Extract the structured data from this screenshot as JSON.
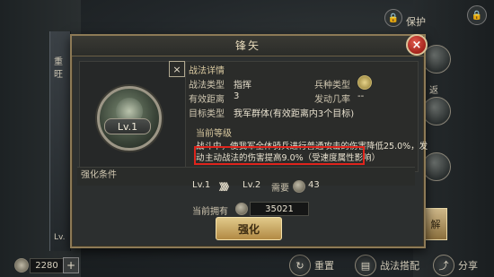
{
  "dialog": {
    "title": "锋矢",
    "close_icon": "×",
    "inner_close_icon": "×",
    "section_title": "战法详情",
    "level_badge": "Lv.1",
    "fields": {
      "type_label": "战法类型",
      "type_value": "指挥",
      "troop_label": "兵种类型",
      "range_label": "有效距离",
      "range_value": "3",
      "rate_label": "发动几率",
      "rate_value": "--",
      "target_label": "目标类型",
      "target_value": "我军群体(有效距离内3个目标)"
    },
    "current_level_label": "当前等级",
    "desc_line1": "战斗中，使我军全体骑兵进行普通攻击的伤害降低25.0%，发",
    "desc_line2_prefix": "动",
    "desc_line2": "主动战法的伤害提高9.0%（受速度属性影响）",
    "upgrade_label": "强化条件",
    "lv_from": "Lv.1",
    "arrows": "》》》",
    "lv_to": "Lv.2",
    "need_label": "需要",
    "need_amount": "43",
    "owned_label": "当前拥有",
    "owned_amount": "35021",
    "strengthen_button": "强化"
  },
  "background": {
    "lock_label": "保护",
    "back_label": "返",
    "solve_label": "解",
    "currency": "2280",
    "plus": "+",
    "reset_label": "重置",
    "combo_label": "战法搭配",
    "share_label": "分享",
    "left_text_1": "重",
    "left_text_2": "旺",
    "left_lv": "Lv."
  },
  "colors": {
    "highlight_border": "#e0241c",
    "close_button": "#c23a2e",
    "button_gold": "#d4b06a"
  }
}
